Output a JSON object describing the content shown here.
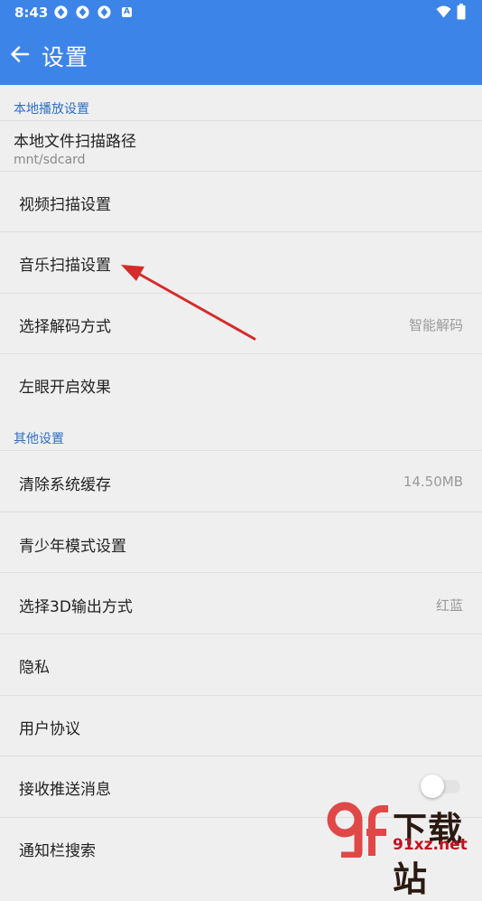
{
  "status_bar": {
    "time": "8:43",
    "icons": [
      "notification-icon",
      "notification-icon",
      "notification-icon",
      "a-icon",
      "wifi-icon",
      "battery-icon"
    ],
    "a_label": "A"
  },
  "app_bar": {
    "title": "设置",
    "back_icon": "arrow-left-icon",
    "color": "#3d84e8"
  },
  "sections": [
    {
      "header": "本地播放设置",
      "items": [
        {
          "label": "本地文件扫描路径",
          "sub": "mnt/sdcard"
        },
        {
          "label": "视频扫描设置"
        },
        {
          "label": "音乐扫描设置"
        },
        {
          "label": "选择解码方式",
          "value": "智能解码"
        },
        {
          "label": "左眼开启效果"
        }
      ]
    },
    {
      "header": "其他设置",
      "items": [
        {
          "label": "清除系统缓存",
          "value": "14.50MB"
        },
        {
          "label": "青少年模式设置"
        },
        {
          "label": "选择3D输出方式",
          "value": "红蓝"
        },
        {
          "label": "隐私"
        },
        {
          "label": "用户协议"
        },
        {
          "label": "接收推送消息",
          "toggle": false
        },
        {
          "label": "通知栏搜索"
        }
      ]
    }
  ],
  "annotation": {
    "color": "#d62b2b"
  },
  "watermark": {
    "big": "下载站",
    "small": "91xz.net",
    "logo": "9f-logo"
  }
}
